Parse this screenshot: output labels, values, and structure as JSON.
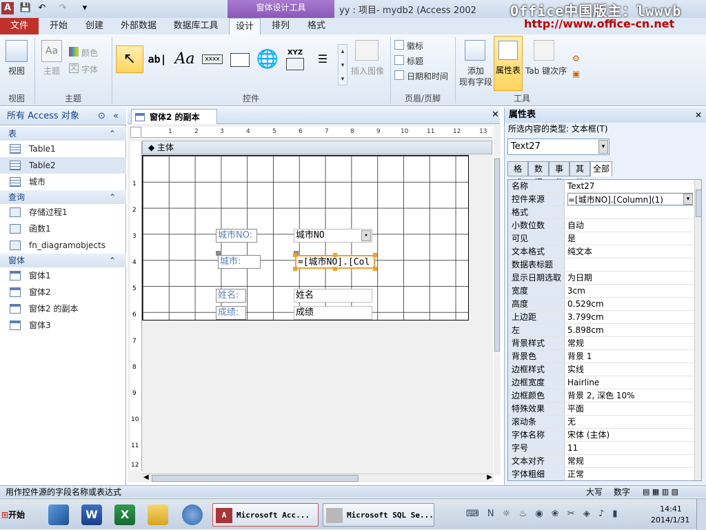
{
  "window": {
    "title": "yy : 项目- mydb2 (Access 2002",
    "contextual_band": "窗体设计工具",
    "watermark": "Office中国版主：lwwvb",
    "watermark_url": "http://www.office-cn.net"
  },
  "ribbon_tabs": {
    "file": "文件",
    "home": "开始",
    "create": "创建",
    "external": "外部数据",
    "dbtools": "数据库工具",
    "design": "设计",
    "arrange": "排列",
    "format": "格式"
  },
  "ribbon": {
    "view": {
      "button": "视图",
      "group": "视图"
    },
    "themes": {
      "theme": "主题",
      "colors": "颜色",
      "fonts": "字体",
      "group": "主题"
    },
    "controls": {
      "group": "控件",
      "text_ab": "ab|",
      "text_aa": "Aa",
      "text_xxxx": "xxxx",
      "text_xyz": "XYZ"
    },
    "insert_image": "插入图像",
    "header_footer": {
      "logo": "徽标",
      "title": "标题",
      "datetime": "日期和时间",
      "group": "页眉/页脚"
    },
    "tools": {
      "add_fields": "添加",
      "add_fields2": "现有字段",
      "property_sheet": "属性表",
      "tab_order": "Tab 键次序",
      "group": "工具"
    }
  },
  "nav": {
    "header": "所有 Access 对象",
    "sections": [
      {
        "title": "表",
        "items": [
          "Table1",
          "Table2",
          "城市"
        ]
      },
      {
        "title": "查询",
        "items": [
          "存储过程1",
          "函数1",
          "fn_diagramobjects"
        ]
      },
      {
        "title": "窗体",
        "items": [
          "窗体1",
          "窗体2",
          "窗体2 的副本",
          "窗体3"
        ]
      }
    ]
  },
  "document": {
    "tab_title": "窗体2 的副本",
    "section": "主体",
    "ruler_h": [
      "1",
      "2",
      "3",
      "4",
      "5",
      "6",
      "7",
      "8",
      "9",
      "10",
      "11",
      "12",
      "13"
    ],
    "ruler_v": [
      "1",
      "2",
      "3",
      "4",
      "5",
      "6",
      "7",
      "8",
      "9",
      "10",
      "11",
      "12"
    ],
    "controls": {
      "lbl_city_no": "城市NO:",
      "cbo_city_no": "城市NO",
      "lbl_city": "城市:",
      "txt_expr": "=[城市NO].[Col",
      "lbl_name": "姓名:",
      "txt_name": "姓名",
      "lbl_score": "成绩:",
      "txt_score": "成绩"
    }
  },
  "property_sheet": {
    "title": "属性表",
    "selection_label": "所选内容的类型: 文本框(T)",
    "selected_control": "Text27",
    "tabs": [
      "格式",
      "数据",
      "事件",
      "其他",
      "全部"
    ],
    "active_tab": "全部",
    "rows": [
      {
        "name": "名称",
        "value": "Text27"
      },
      {
        "name": "控件来源",
        "value": "=[城市NO].[Column](1)"
      },
      {
        "name": "格式",
        "value": ""
      },
      {
        "name": "小数位数",
        "value": "自动"
      },
      {
        "name": "可见",
        "value": "是"
      },
      {
        "name": "文本格式",
        "value": "纯文本"
      },
      {
        "name": "数据表标题",
        "value": ""
      },
      {
        "name": "显示日期选取",
        "value": "为日期"
      },
      {
        "name": "宽度",
        "value": "3cm"
      },
      {
        "name": "高度",
        "value": "0.529cm"
      },
      {
        "name": "上边距",
        "value": "3.799cm"
      },
      {
        "name": "左",
        "value": "5.898cm"
      },
      {
        "name": "背景样式",
        "value": "常规"
      },
      {
        "name": "背景色",
        "value": "背景 1"
      },
      {
        "name": "边框样式",
        "value": "实线"
      },
      {
        "name": "边框宽度",
        "value": "Hairline"
      },
      {
        "name": "边框颜色",
        "value": "背景 2, 深色 10%"
      },
      {
        "name": "特殊效果",
        "value": "平面"
      },
      {
        "name": "滚动条",
        "value": "无"
      },
      {
        "name": "字体名称",
        "value": "宋体 (主体)"
      },
      {
        "name": "字号",
        "value": "11"
      },
      {
        "name": "文本对齐",
        "value": "常规"
      },
      {
        "name": "字体粗细",
        "value": "正常"
      }
    ]
  },
  "status": {
    "message": "用作控件源的字段名称或表达式",
    "caps": "大写",
    "num": "数字"
  },
  "taskbar": {
    "start": "开始",
    "app1": "Microsoft Acc...",
    "app2": "Microsoft SQL Se...",
    "time": "14:41",
    "date": "2014/1/31"
  }
}
